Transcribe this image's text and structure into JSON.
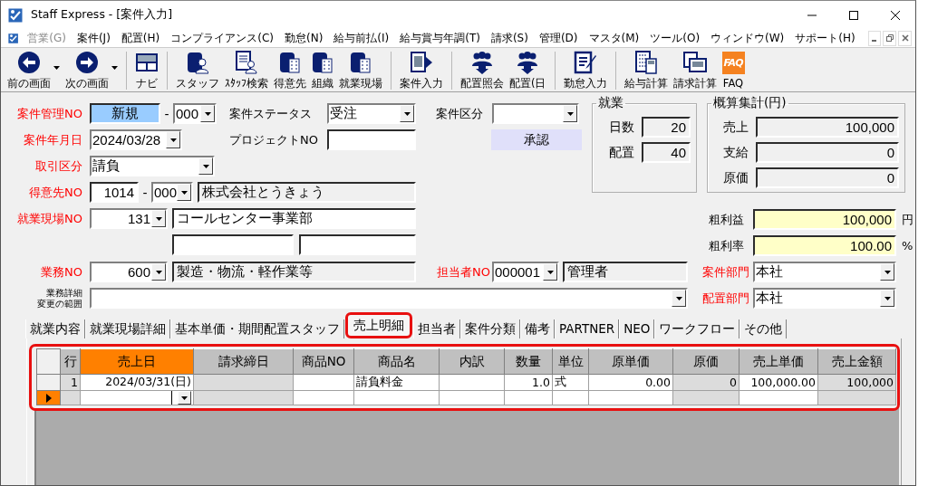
{
  "window": {
    "title": "Staff Express - [案件入力]"
  },
  "menu": [
    {
      "label": "営業(G)",
      "disabled": true
    },
    {
      "label": "案件(J)",
      "disabled": false
    },
    {
      "label": "配置(H)",
      "disabled": false
    },
    {
      "label": "コンプライアンス(C)",
      "disabled": false
    },
    {
      "label": "勤怠(N)",
      "disabled": false
    },
    {
      "label": "給与前払(I)",
      "disabled": false
    },
    {
      "label": "給与賞与年調(T)",
      "disabled": false
    },
    {
      "label": "請求(S)",
      "disabled": false
    },
    {
      "label": "管理(D)",
      "disabled": false
    },
    {
      "label": "マスタ(M)",
      "disabled": false
    },
    {
      "label": "ツール(O)",
      "disabled": false
    },
    {
      "label": "ウィンドウ(W)",
      "disabled": false
    },
    {
      "label": "サポート(H)",
      "disabled": false
    }
  ],
  "toolbar": {
    "groups": [
      [
        {
          "label": "前の画面",
          "dropdown": true
        },
        {
          "label": "次の画面",
          "dropdown": true
        }
      ],
      [
        {
          "label": "ナビ",
          "dropdown": false
        }
      ],
      [
        {
          "label": "スタッフ",
          "dropdown": false
        },
        {
          "label": "ｽﾀｯﾌ検索",
          "dropdown": false
        },
        {
          "label": "得意先",
          "dropdown": false
        },
        {
          "label": "組織",
          "dropdown": false
        },
        {
          "label": "就業現場",
          "dropdown": false
        }
      ],
      [
        {
          "label": "案件入力",
          "dropdown": false
        }
      ],
      [
        {
          "label": "配置照会",
          "dropdown": false
        },
        {
          "label": "配置(日",
          "dropdown": false
        }
      ],
      [
        {
          "label": "勤怠入力",
          "dropdown": false
        }
      ],
      [
        {
          "label": "給与計算",
          "dropdown": false
        },
        {
          "label": "請求計算",
          "dropdown": false
        },
        {
          "label": "FAQ",
          "dropdown": false,
          "icon_text": "FAQ"
        }
      ]
    ]
  },
  "form": {
    "case_no": {
      "label": "案件管理NO",
      "required": true,
      "value": "新規",
      "separator": "-",
      "sub": "000"
    },
    "status": {
      "label": "案件ステータス",
      "required": false,
      "value": "受注"
    },
    "category": {
      "label": "案件区分",
      "required": false
    },
    "approve_button": "承認",
    "date": {
      "label": "案件年月日",
      "required": true,
      "value": "2024/03/28"
    },
    "project": {
      "label": "プロジェクトNO",
      "required": false
    },
    "deal_type": {
      "label": "取引区分",
      "required": true,
      "value": "請負"
    },
    "client": {
      "label": "得意先NO",
      "required": true,
      "value": "1014",
      "separator": "-",
      "sub": "000",
      "name": "株式会社とうきょう"
    },
    "site": {
      "label": "就業現場NO",
      "required": true,
      "value": "131",
      "name": "コールセンター事業部"
    },
    "work": {
      "label": "業務NO",
      "required": true,
      "value": "600",
      "name": "製造・物流・軽作業等"
    },
    "manager": {
      "label": "担当者NO",
      "required": true,
      "value": "000001",
      "name": "管理者"
    },
    "case_dept": {
      "label": "案件部門",
      "required": true,
      "value": "本社"
    },
    "work_detail": {
      "label_lines": [
        "業務詳細",
        "変更の範囲"
      ],
      "required": false
    },
    "placement_dept": {
      "label": "配置部門",
      "required": true,
      "value": "本社"
    }
  },
  "work_summary": {
    "title": "就業",
    "rows": [
      {
        "label": "日数",
        "value": "20"
      },
      {
        "label": "配置",
        "value": "40"
      }
    ]
  },
  "estimate": {
    "title": "概算集計(円)",
    "rows": [
      {
        "label": "売上",
        "value": "100,000"
      },
      {
        "label": "支給",
        "value": "0"
      },
      {
        "label": "原価",
        "value": "0"
      }
    ]
  },
  "profit": [
    {
      "label": "粗利益",
      "value": "100,000",
      "unit": "円"
    },
    {
      "label": "粗利率",
      "value": "100.00",
      "unit": "%"
    }
  ],
  "tabs": [
    {
      "label": "就業内容",
      "selected": false,
      "annotated": false
    },
    {
      "label": "就業現場詳細",
      "selected": false,
      "annotated": false
    },
    {
      "label": "基本単価・期間配置スタッフ",
      "selected": false,
      "annotated": false
    },
    {
      "label": "売上明細",
      "selected": true,
      "annotated": true
    },
    {
      "label": "担当者",
      "selected": false,
      "annotated": false
    },
    {
      "label": "案件分類",
      "selected": false,
      "annotated": false
    },
    {
      "label": "備考",
      "selected": false,
      "annotated": false
    },
    {
      "label": "PARTNER",
      "selected": false,
      "annotated": false
    },
    {
      "label": "NEO",
      "selected": false,
      "annotated": false
    },
    {
      "label": "ワークフロー",
      "selected": false,
      "annotated": false
    },
    {
      "label": "その他",
      "selected": false,
      "annotated": false
    }
  ],
  "sales_table": {
    "annotated": true,
    "columns": [
      {
        "label": "行",
        "selected": false,
        "readonly": true
      },
      {
        "label": "売上日",
        "selected": true,
        "readonly": false
      },
      {
        "label": "請求締日",
        "selected": false,
        "readonly": true
      },
      {
        "label": "商品NO",
        "selected": false,
        "readonly": false
      },
      {
        "label": "商品名",
        "selected": false,
        "readonly": false
      },
      {
        "label": "内訳",
        "selected": false,
        "readonly": false
      },
      {
        "label": "数量",
        "selected": false,
        "readonly": false
      },
      {
        "label": "単位",
        "selected": false,
        "readonly": false
      },
      {
        "label": "原単価",
        "selected": false,
        "readonly": false
      },
      {
        "label": "原価",
        "selected": false,
        "readonly": true
      },
      {
        "label": "売上単価",
        "selected": false,
        "readonly": false
      },
      {
        "label": "売上金額",
        "selected": false,
        "readonly": true
      }
    ],
    "rows": [
      {
        "current": false,
        "cells": [
          "1",
          "2024/03/31(日)",
          null,
          null,
          "請負料金",
          null,
          "1.0",
          "式",
          "0.00",
          "0",
          "100,000.00",
          "100,000"
        ]
      },
      {
        "current": true,
        "cells": [
          null,
          null,
          null,
          null,
          null,
          null,
          null,
          null,
          null,
          null,
          null,
          null
        ]
      }
    ]
  }
}
